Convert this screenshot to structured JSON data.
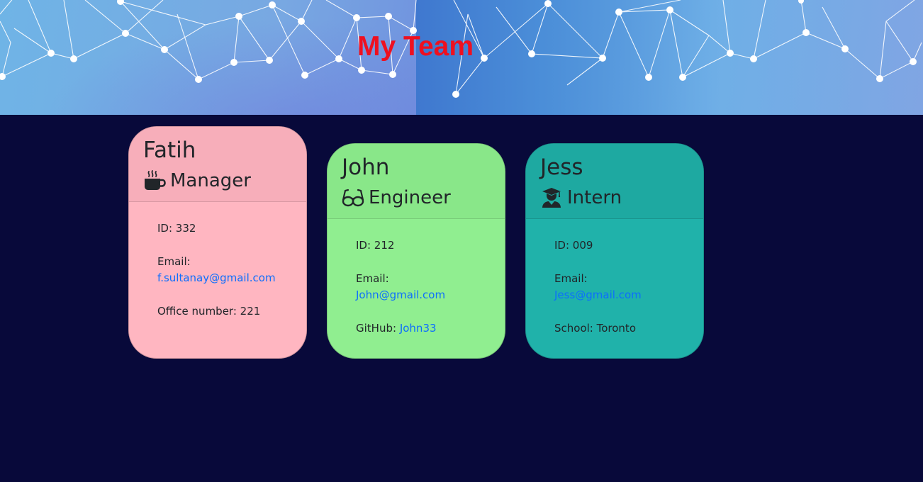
{
  "header": {
    "title": "My Team"
  },
  "colors": {
    "background": "#08093a",
    "title": "#ee1020",
    "manager_card": "#ffb6c1",
    "engineer_card": "#90ee90",
    "intern_card": "#20b2aa",
    "link": "#0d6efd"
  },
  "cards": [
    {
      "name": "Fatih",
      "role": "Manager",
      "icon": "coffee-mug-icon",
      "id_label": "ID: 332",
      "email_label": "Email:",
      "email": "f.sultanay@gmail.com",
      "extra_label": "Office number: 221"
    },
    {
      "name": "John",
      "role": "Engineer",
      "icon": "glasses-icon",
      "id_label": "ID: 212",
      "email_label": "Email:",
      "email": "John@gmail.com",
      "extra_label": "GitHub:",
      "extra_link": "John33"
    },
    {
      "name": "Jess",
      "role": "Intern",
      "icon": "graduate-icon",
      "id_label": "ID: 009",
      "email_label": "Email:",
      "email": "Jess@gmail.com",
      "extra_label": "School: Toronto"
    }
  ]
}
